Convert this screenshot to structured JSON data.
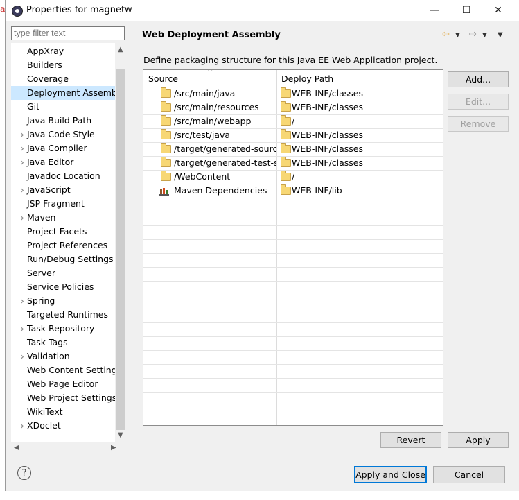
{
  "window": {
    "title": "Properties for magnetw",
    "minimize": "—",
    "maximize": "☐",
    "close": "✕"
  },
  "filter": {
    "placeholder": "type filter text"
  },
  "tree": {
    "items": [
      {
        "label": "AppXray",
        "expandable": false
      },
      {
        "label": "Builders",
        "expandable": false
      },
      {
        "label": "Coverage",
        "expandable": false
      },
      {
        "label": "Deployment Assembly",
        "expandable": false,
        "selected": true
      },
      {
        "label": "Git",
        "expandable": false
      },
      {
        "label": "Java Build Path",
        "expandable": false
      },
      {
        "label": "Java Code Style",
        "expandable": true
      },
      {
        "label": "Java Compiler",
        "expandable": true
      },
      {
        "label": "Java Editor",
        "expandable": true
      },
      {
        "label": "Javadoc Location",
        "expandable": false
      },
      {
        "label": "JavaScript",
        "expandable": true
      },
      {
        "label": "JSP Fragment",
        "expandable": false
      },
      {
        "label": "Maven",
        "expandable": true
      },
      {
        "label": "Project Facets",
        "expandable": false
      },
      {
        "label": "Project References",
        "expandable": false
      },
      {
        "label": "Run/Debug Settings",
        "expandable": false
      },
      {
        "label": "Server",
        "expandable": false
      },
      {
        "label": "Service Policies",
        "expandable": false
      },
      {
        "label": "Spring",
        "expandable": true
      },
      {
        "label": "Targeted Runtimes",
        "expandable": false
      },
      {
        "label": "Task Repository",
        "expandable": true
      },
      {
        "label": "Task Tags",
        "expandable": false
      },
      {
        "label": "Validation",
        "expandable": true
      },
      {
        "label": "Web Content Settings",
        "expandable": false
      },
      {
        "label": "Web Page Editor",
        "expandable": false
      },
      {
        "label": "Web Project Settings",
        "expandable": false
      },
      {
        "label": "WikiText",
        "expandable": false
      },
      {
        "label": "XDoclet",
        "expandable": true
      }
    ]
  },
  "page": {
    "title": "Web Deployment Assembly",
    "description": "Define packaging structure for this Java EE Web Application project."
  },
  "table": {
    "columns": [
      "Source",
      "Deploy Path"
    ],
    "rows": [
      {
        "source": "/src/main/java",
        "deploy": "WEB-INF/classes",
        "icon": "folder"
      },
      {
        "source": "/src/main/resources",
        "deploy": "WEB-INF/classes",
        "icon": "folder"
      },
      {
        "source": "/src/main/webapp",
        "deploy": "/",
        "icon": "folder"
      },
      {
        "source": "/src/test/java",
        "deploy": "WEB-INF/classes",
        "icon": "folder"
      },
      {
        "source": "/target/generated-sources/annotations",
        "deploy": "WEB-INF/classes",
        "icon": "folder"
      },
      {
        "source": "/target/generated-test-sources/test-annotations",
        "deploy": "WEB-INF/classes",
        "icon": "folder"
      },
      {
        "source": "/WebContent",
        "deploy": "/",
        "icon": "folder"
      },
      {
        "source": "Maven Dependencies",
        "deploy": "WEB-INF/lib",
        "icon": "maven-library"
      }
    ]
  },
  "buttons": {
    "add": "Add...",
    "edit": "Edit...",
    "remove": "Remove",
    "revert": "Revert",
    "apply": "Apply",
    "apply_and_close": "Apply and Close",
    "cancel": "Cancel"
  },
  "colors": {
    "selection": "#cce8ff",
    "default_button_border": "#0078d7"
  }
}
